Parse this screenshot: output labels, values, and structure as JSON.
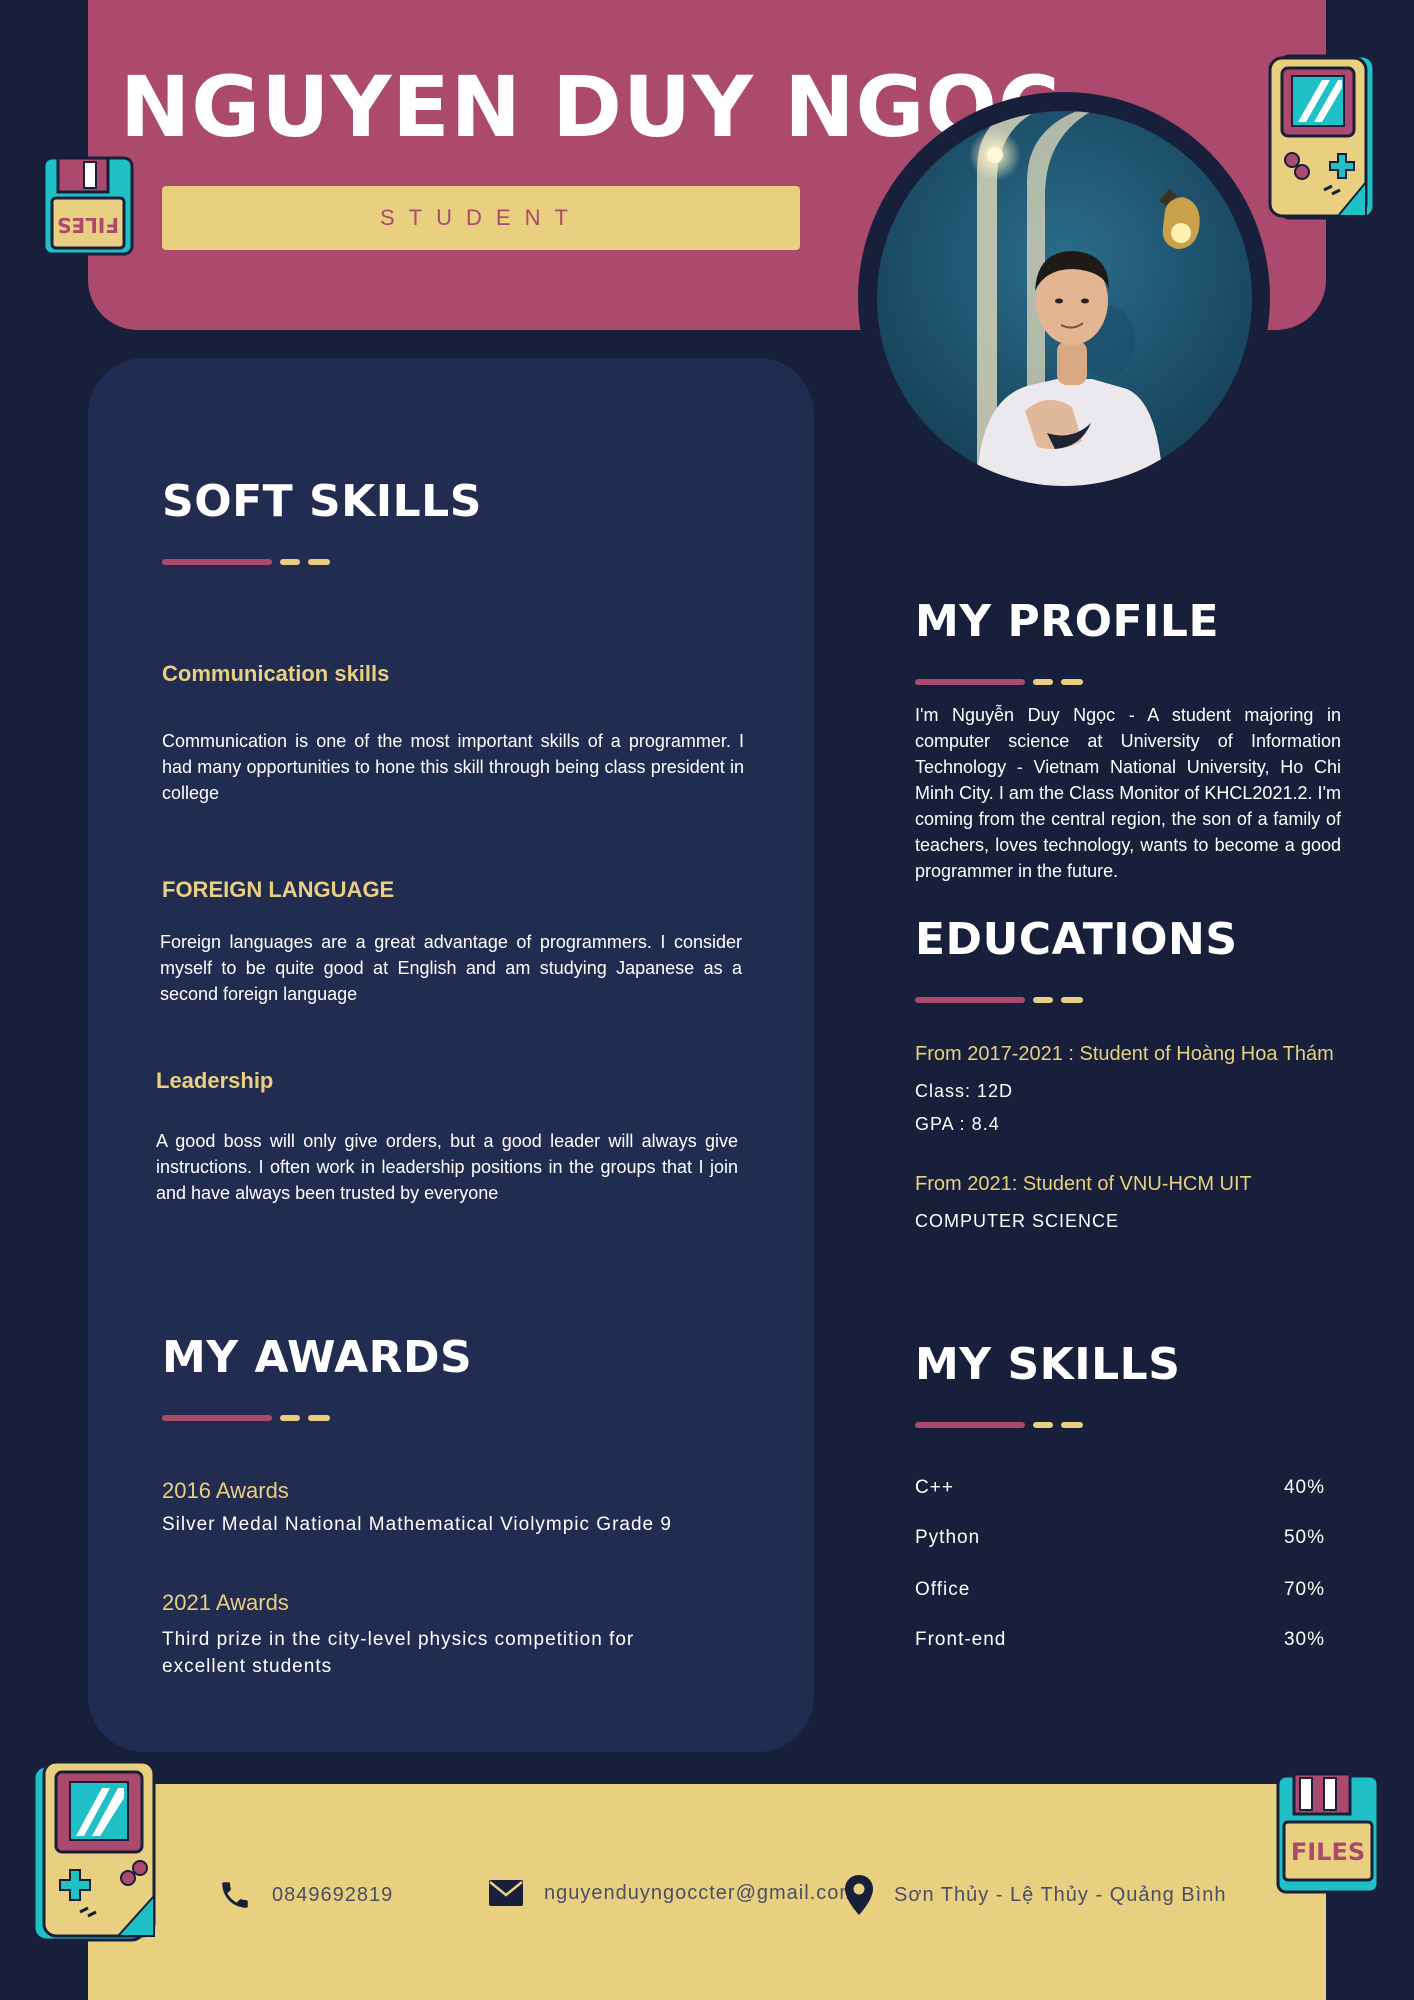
{
  "header": {
    "name": "NGUYEN DUY NGOC",
    "role": "STUDENT"
  },
  "soft_skills": {
    "heading": "SOFT SKILLS",
    "items": [
      {
        "title": "Communication skills",
        "text": "Communication is one of the most important skills of a programmer. I had many opportunities to hone this skill through being class president in college"
      },
      {
        "title": "FOREIGN LANGUAGE",
        "text": "Foreign languages are a great advantage of programmers. I consider myself to be quite good at English and am studying Japanese as a second foreign language"
      },
      {
        "title": "Leadership",
        "text": "A good boss will only give orders, but a good leader will always give instructions. I often work in leadership positions in the groups that I join and have always been trusted by everyone"
      }
    ]
  },
  "awards": {
    "heading": "MY AWARDS",
    "items": [
      {
        "year": "2016 Awards",
        "text": "Silver Medal National Mathematical Violympic Grade 9"
      },
      {
        "year": "2021 Awards",
        "text": "Third prize in the city-level physics competition for excellent students"
      }
    ]
  },
  "profile": {
    "heading": "MY PROFILE",
    "text": "I'm Nguyễn Duy Ngọc - A student majoring in computer science at University of Information Technology - Vietnam National University, Ho Chi Minh City. I am the Class Monitor of KHCL2021.2. I'm coming from the central region, the son of a family of teachers, loves technology, wants to become a good programmer in the future."
  },
  "education": {
    "heading": "EDUCATIONS",
    "entries": [
      {
        "title": "From 2017-2021 : Student of Hoàng Hoa Thám",
        "lines": [
          "Class: 12D",
          "GPA : 8.4"
        ]
      },
      {
        "title": "From 2021: Student of VNU-HCM UIT",
        "lines": [
          "COMPUTER SCIENCE"
        ]
      }
    ]
  },
  "skills": {
    "heading": "MY SKILLS",
    "items": [
      {
        "name": "C++",
        "percent": "40%"
      },
      {
        "name": "Python",
        "percent": "50%"
      },
      {
        "name": "Office",
        "percent": "70%"
      },
      {
        "name": "Front-end",
        "percent": "30%"
      }
    ]
  },
  "contact": {
    "phone": "0849692819",
    "email": "nguyenduyngoccter@gmail.com",
    "address": "Sơn Thủy - Lệ Thủy - Quảng Bình"
  },
  "stickers": {
    "floppy_label": "FILES"
  },
  "colors": {
    "background": "#181f3a",
    "panel": "#222b50",
    "accent_pink": "#ab4a6c",
    "accent_yellow": "#e8d080",
    "teal": "#1fc0c6"
  }
}
